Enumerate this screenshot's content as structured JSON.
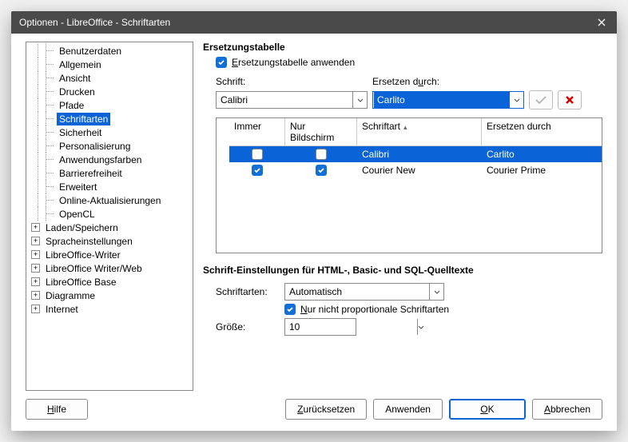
{
  "window": {
    "title": "Optionen - LibreOffice - Schriftarten"
  },
  "tree": {
    "children": [
      "Benutzerdaten",
      "Allgemein",
      "Ansicht",
      "Drucken",
      "Pfade",
      "Schriftarten",
      "Sicherheit",
      "Personalisierung",
      "Anwendungsfarben",
      "Barrierefreiheit",
      "Erweitert",
      "Online-Aktualisierungen",
      "OpenCL"
    ],
    "selected": "Schriftarten",
    "siblings": [
      "Laden/Speichern",
      "Spracheinstellungen",
      "LibreOffice-Writer",
      "LibreOffice Writer/Web",
      "LibreOffice Base",
      "Diagramme",
      "Internet"
    ]
  },
  "replacement": {
    "title": "Ersetzungstabelle",
    "apply_label_pre": "E",
    "apply_label_post": "rsetzungstabelle anwenden",
    "font_label": "Schrift:",
    "replace_label_pre": "Ersetzen d",
    "replace_label_u": "u",
    "replace_label_post": "rch:",
    "font_value": "Calibri",
    "replace_value": "Carlito",
    "headers": {
      "immer": "Immer",
      "screen": "Nur Bildschirm",
      "font": "Schriftart",
      "replace": "Ersetzen durch"
    },
    "rows": [
      {
        "immer": false,
        "screen": false,
        "font": "Calibri",
        "replace": "Carlito",
        "selected": true
      },
      {
        "immer": true,
        "screen": true,
        "font": "Courier New",
        "replace": "Courier Prime",
        "selected": false
      }
    ]
  },
  "source": {
    "title": "Schrift-Einstellungen für HTML-, Basic- und SQL-Quelltexte",
    "fonts_label": "Schriftarten:",
    "fonts_value": "Automatisch",
    "nonprop_pre": "N",
    "nonprop_post": "ur nicht proportionale Schriftarten",
    "size_label": "Größe:",
    "size_value": "10"
  },
  "buttons": {
    "help_u": "H",
    "help_post": "ilfe",
    "reset_u": "Z",
    "reset_post": "urücksetzen",
    "apply": "Anwenden",
    "ok_u": "O",
    "ok_post": "K",
    "cancel_u": "A",
    "cancel_post": "bbrechen"
  }
}
